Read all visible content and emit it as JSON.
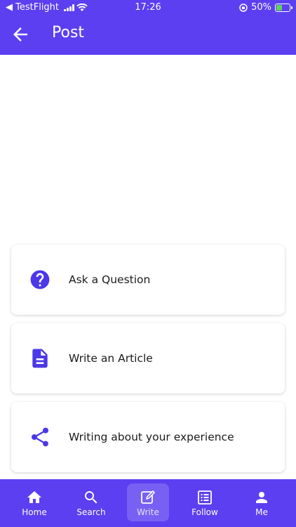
{
  "status_bar": {
    "carrier": "◀ TestFlight",
    "time": "17:26",
    "battery_percent": "50%",
    "battery_level": 0.5
  },
  "header": {
    "title": "Post",
    "back_icon": "arrow-left-icon"
  },
  "options": [
    {
      "label": "Ask a Question",
      "icon": "question-circle-icon"
    },
    {
      "label": "Write an Article",
      "icon": "article-icon"
    },
    {
      "label": "Writing about your experience",
      "icon": "share-icon"
    }
  ],
  "bottom_nav": {
    "items": [
      {
        "label": "Home",
        "icon": "home-icon"
      },
      {
        "label": "Search",
        "icon": "search-icon"
      },
      {
        "label": "Write",
        "icon": "edit-icon",
        "active": true
      },
      {
        "label": "Follow",
        "icon": "list-icon"
      },
      {
        "label": "Me",
        "icon": "person-icon"
      }
    ]
  },
  "colors": {
    "primary": "#5b3ff0",
    "icon_accent": "#4b38e8",
    "background": "#ffffff"
  }
}
